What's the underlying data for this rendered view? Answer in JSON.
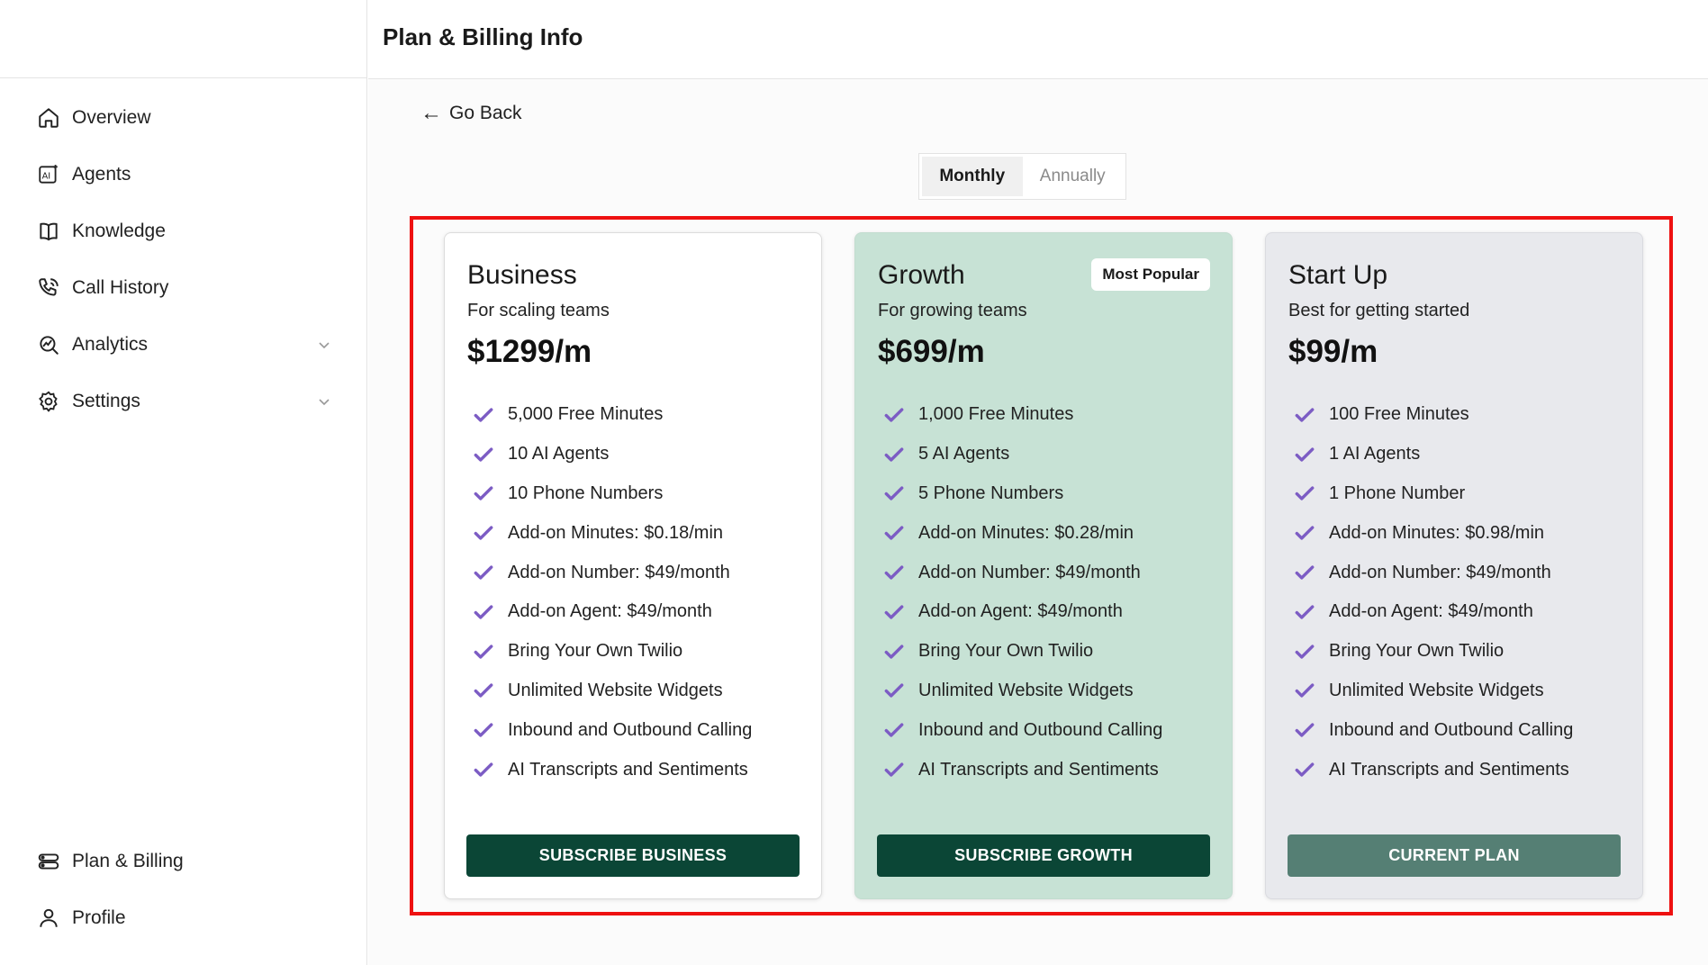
{
  "header": {
    "title": "Plan & Billing Info"
  },
  "sidebar": {
    "items": [
      {
        "label": "Overview",
        "icon": "home-icon"
      },
      {
        "label": "Agents",
        "icon": "ai-agent-icon"
      },
      {
        "label": "Knowledge",
        "icon": "book-icon"
      },
      {
        "label": "Call History",
        "icon": "phone-call-icon"
      },
      {
        "label": "Analytics",
        "icon": "analytics-icon",
        "expandable": true
      },
      {
        "label": "Settings",
        "icon": "gear-icon",
        "expandable": true
      }
    ],
    "bottom_items": [
      {
        "label": "Plan & Billing",
        "icon": "billing-icon"
      },
      {
        "label": "Profile",
        "icon": "user-icon"
      }
    ]
  },
  "go_back": {
    "label": "Go Back"
  },
  "billing_toggle": {
    "options": [
      "Monthly",
      "Annually"
    ],
    "selected": "Monthly"
  },
  "plans": [
    {
      "name": "Business",
      "tagline": "For scaling teams",
      "price": "$1299/m",
      "features": [
        "5,000 Free Minutes",
        "10 AI Agents",
        "10 Phone Numbers",
        "Add-on Minutes: $0.18/min",
        "Add-on Number: $49/month",
        "Add-on Agent: $49/month",
        "Bring Your Own Twilio",
        "Unlimited Website Widgets",
        "Inbound and Outbound Calling",
        "AI Transcripts and Sentiments"
      ],
      "cta": "SUBSCRIBE BUSINESS"
    },
    {
      "name": "Growth",
      "badge": "Most Popular",
      "tagline": "For growing teams",
      "price": "$699/m",
      "features": [
        "1,000 Free Minutes",
        "5 AI Agents",
        "5 Phone Numbers",
        "Add-on Minutes: $0.28/min",
        "Add-on Number: $49/month",
        "Add-on Agent: $49/month",
        "Bring Your Own Twilio",
        "Unlimited Website Widgets",
        "Inbound and Outbound Calling",
        "AI Transcripts and Sentiments"
      ],
      "cta": "SUBSCRIBE GROWTH"
    },
    {
      "name": "Start Up",
      "tagline": "Best for getting started",
      "price": "$99/m",
      "features": [
        "100 Free Minutes",
        "1 AI Agents",
        "1 Phone Number",
        "Add-on Minutes: $0.98/min",
        "Add-on Number: $49/month",
        "Add-on Agent: $49/month",
        "Bring Your Own Twilio",
        "Unlimited Website Widgets",
        "Inbound and Outbound Calling",
        "AI Transcripts and Sentiments"
      ],
      "cta": "CURRENT PLAN"
    }
  ],
  "colors": {
    "check": "#7c5cc4",
    "cta_dark": "#0b4636",
    "cta_current": "#557f74",
    "growth_bg": "#c7e2d5",
    "startup_bg": "#e8e9ed",
    "highlight": "#ee1111"
  }
}
